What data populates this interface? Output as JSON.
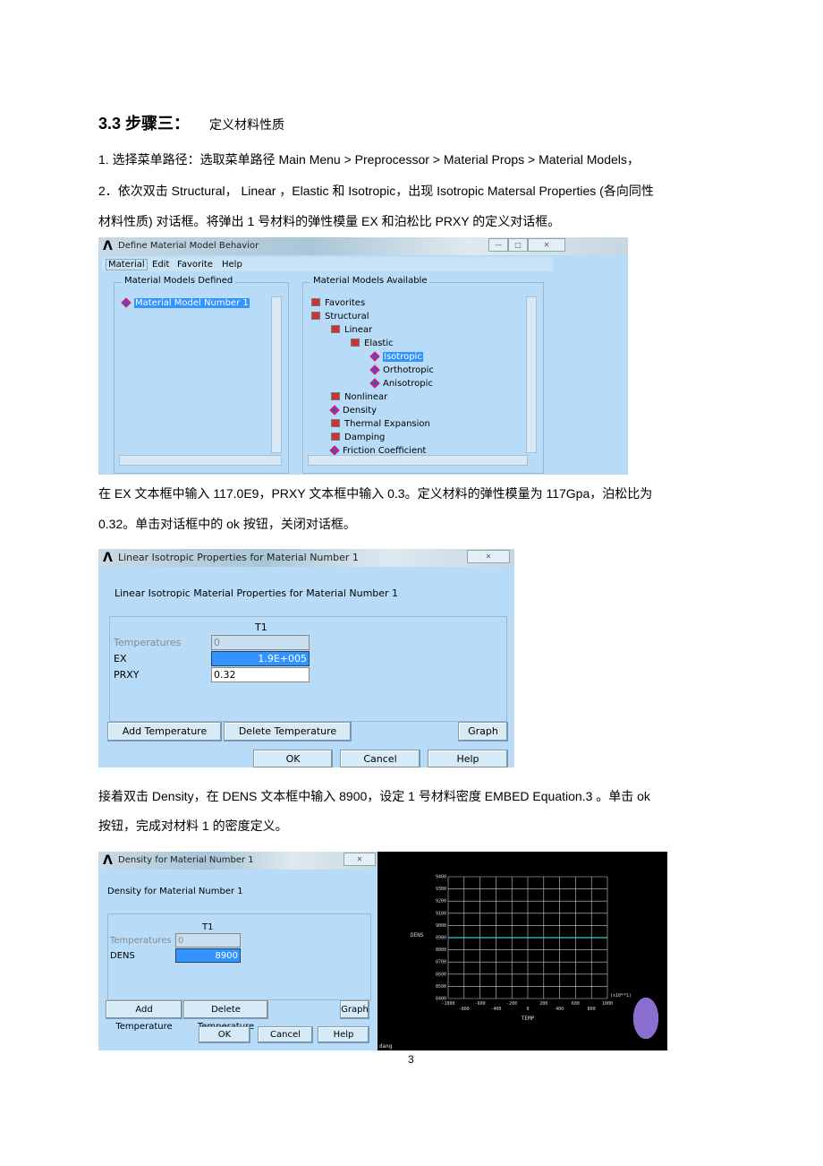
{
  "heading": {
    "number": "3.3 步骤三：",
    "title": "定义材料性质"
  },
  "paragraphs": [
    "1. 选择菜单路径：选取菜单路径 Main Menu > Preprocessor > Material Props > Material Models，",
    "2．依次双击 Structural， Linear ，Elastic  和 Isotropic，出现 Isotropic Matersal Properties (各向同性",
    "材料性质) 对话框。将弹出 1 号材料的弹性模量 EX 和泊松比 PRXY 的定义对话框。",
    "在 EX 文本框中输入 117.0E9，PRXY 文本框中输入 0.3。定义材料的弹性模量为 117Gpa，泊松比为",
    "0.32。单击对话框中的 ok 按钮，关闭对话框。",
    "接着双击 Density，在 DENS 文本框中输入 8900，设定 1 号材料密度  EMBED Equation.3    。单击 ok",
    "按钮，完成对材料 1 的密度定义。"
  ],
  "dialog1": {
    "title": "Define Material Model Behavior",
    "menu": [
      "Material",
      "Edit",
      "Favorite",
      "Help"
    ],
    "defined_label": "Material Models Defined",
    "defined_items": [
      "Material Model Number 1"
    ],
    "available_label": "Material Models Available",
    "tree": [
      {
        "label": "Favorites",
        "level": 0,
        "icon": "folder-icon"
      },
      {
        "label": "Structural",
        "level": 0,
        "icon": "open-folder-icon"
      },
      {
        "label": "Linear",
        "level": 1,
        "icon": "open-folder-icon"
      },
      {
        "label": "Elastic",
        "level": 2,
        "icon": "open-folder-icon"
      },
      {
        "label": "Isotropic",
        "level": 3,
        "icon": "material-icon",
        "selected": true
      },
      {
        "label": "Orthotropic",
        "level": 3,
        "icon": "material-icon"
      },
      {
        "label": "Anisotropic",
        "level": 3,
        "icon": "material-icon"
      },
      {
        "label": "Nonlinear",
        "level": 1,
        "icon": "folder-icon"
      },
      {
        "label": "Density",
        "level": 1,
        "icon": "material-icon"
      },
      {
        "label": "Thermal Expansion",
        "level": 1,
        "icon": "folder-icon"
      },
      {
        "label": "Damping",
        "level": 1,
        "icon": "folder-icon"
      },
      {
        "label": "Friction Coefficient",
        "level": 1,
        "icon": "material-icon"
      }
    ]
  },
  "dialog2": {
    "title": "Linear Isotropic Properties for Material Number 1",
    "heading": "Linear Isotropic Material Properties for Material Number 1",
    "column": "T1",
    "rows": [
      {
        "label": "Temperatures",
        "value": "0"
      },
      {
        "label": "EX",
        "value": "1.9E+005"
      },
      {
        "label": "PRXY",
        "value": "0.32"
      }
    ],
    "buttons": {
      "add": "Add Temperature",
      "delete": "Delete Temperature",
      "graph": "Graph",
      "ok": "OK",
      "cancel": "Cancel",
      "help": "Help"
    }
  },
  "dialog3": {
    "title": "Density for Material Number 1",
    "heading": "Density for Material Number 1",
    "column": "T1",
    "rows": [
      {
        "label": "Temperatures",
        "value": "0"
      },
      {
        "label": "DENS",
        "value": "8900"
      }
    ],
    "buttons": {
      "add": "Add Temperature",
      "delete": "Delete Temperature",
      "graph": "Graph",
      "ok": "OK",
      "cancel": "Cancel",
      "help": "Help"
    }
  },
  "chart_data": {
    "type": "line",
    "xlabel": "TEMP",
    "ylabel": "DENS",
    "x_multiplier": "(x10**1)",
    "xlim": [
      -1000,
      1000
    ],
    "ylim": [
      8400,
      9400
    ],
    "xticks": [
      -1000,
      -800,
      -600,
      -400,
      -200,
      0,
      200,
      400,
      600,
      800,
      1000
    ],
    "yticks": [
      8400,
      8500,
      8600,
      8700,
      8800,
      8900,
      9000,
      9100,
      9200,
      9300,
      9400
    ],
    "grid": true,
    "series": [
      {
        "x": [
          -1000,
          1000
        ],
        "y": [
          8900,
          8900
        ],
        "color": "#2ec8d8"
      }
    ],
    "background": "#000000",
    "corner_text": "dang"
  },
  "page_number": "3"
}
